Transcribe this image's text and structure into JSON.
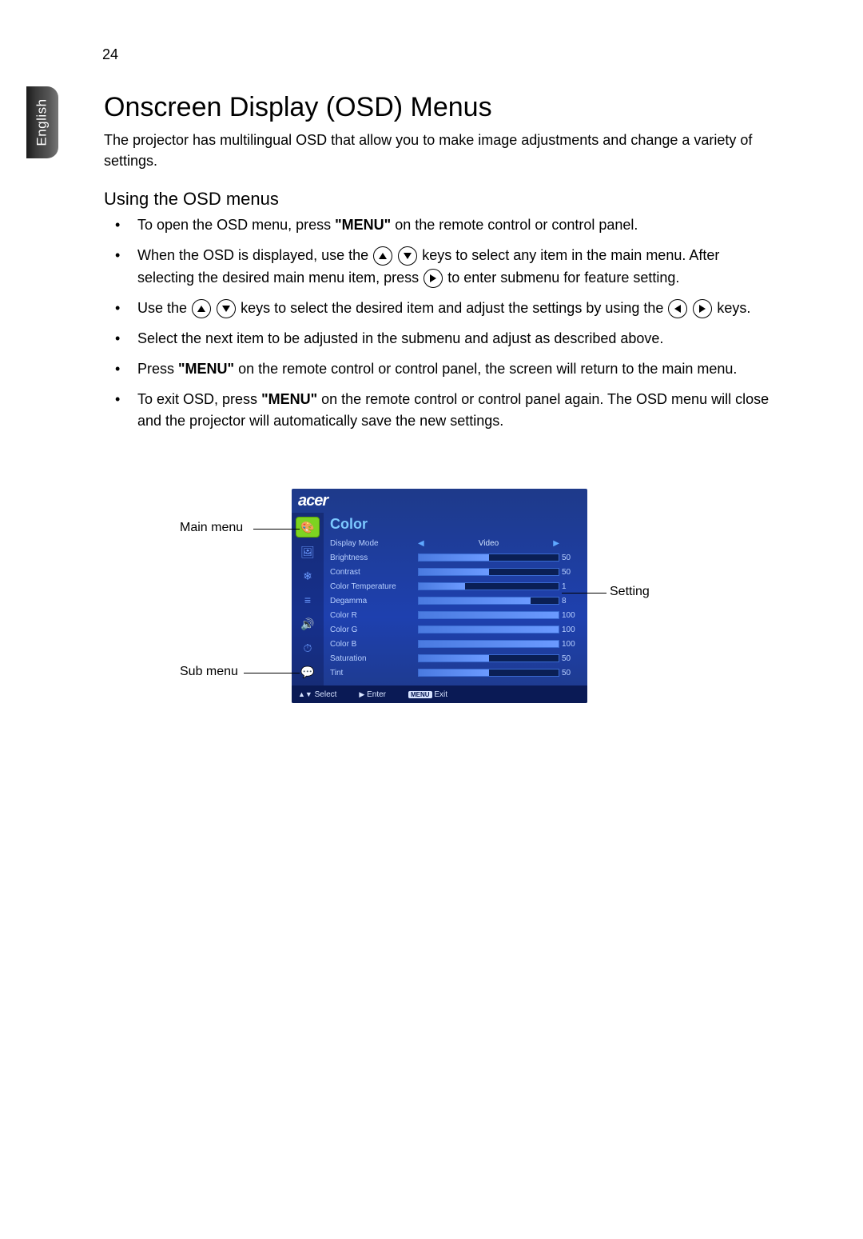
{
  "page_number": "24",
  "language_tab": "English",
  "title": "Onscreen Display (OSD) Menus",
  "intro": "The projector has multilingual OSD that allow you to make image adjustments and change a variety of settings.",
  "subtitle": "Using the OSD menus",
  "bullets": {
    "b1": "To open the OSD menu, press ",
    "b1_menu": "\"MENU\"",
    "b1_end": " on the remote control or control panel.",
    "b2_a": "When the OSD is displayed, use the ",
    "b2_b": " keys to select any item in the main menu. After selecting the desired main menu item, press ",
    "b2_c": " to enter submenu for feature setting.",
    "b3_a": "Use the ",
    "b3_b": " keys to select the desired item and adjust the settings by using the ",
    "b3_c": " keys.",
    "b4": "Select the next item to be adjusted in the submenu and adjust as described above.",
    "b5_a": "Press ",
    "b5_menu": "\"MENU\"",
    "b5_b": " on the remote control or control panel, the screen will return to the main menu.",
    "b6_a": "To exit OSD, press ",
    "b6_menu": "\"MENU\"",
    "b6_b": " on the remote control or control panel again. The OSD menu will close and the projector will automatically save the new settings."
  },
  "callouts": {
    "main": "Main menu",
    "sub": "Sub menu",
    "setting": "Setting"
  },
  "osd": {
    "brand": "acer",
    "section": "Color",
    "side_icons": [
      "palette-icon",
      "image-icon",
      "gear-icon",
      "sliders-icon",
      "audio-icon",
      "timer-icon",
      "lang-icon"
    ],
    "rows": [
      {
        "label": "Display Mode",
        "type": "select",
        "value": "Video"
      },
      {
        "label": "Brightness",
        "type": "bar",
        "value": 50,
        "max": 100
      },
      {
        "label": "Contrast",
        "type": "bar",
        "value": 50,
        "max": 100
      },
      {
        "label": "Color Temperature",
        "type": "bar",
        "value": 1,
        "max": 3
      },
      {
        "label": "Degamma",
        "type": "bar",
        "value": 8,
        "max": 10
      },
      {
        "label": "Color R",
        "type": "bar",
        "value": 100,
        "max": 100
      },
      {
        "label": "Color G",
        "type": "bar",
        "value": 100,
        "max": 100
      },
      {
        "label": "Color B",
        "type": "bar",
        "value": 100,
        "max": 100
      },
      {
        "label": "Saturation",
        "type": "bar",
        "value": 50,
        "max": 100
      },
      {
        "label": "Tint",
        "type": "bar",
        "value": 50,
        "max": 100
      }
    ],
    "footer": {
      "select": "Select",
      "enter": "Enter",
      "menu": "MENU",
      "exit": "Exit"
    }
  }
}
